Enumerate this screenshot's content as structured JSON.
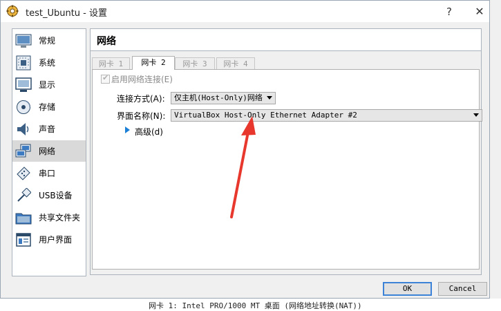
{
  "window": {
    "title": "test_Ubuntu - 设置",
    "help_symbol": "?",
    "close_symbol": "✕"
  },
  "sidebar": {
    "items": [
      {
        "label": "常规",
        "icon": "general-icon"
      },
      {
        "label": "系统",
        "icon": "system-icon"
      },
      {
        "label": "显示",
        "icon": "display-icon"
      },
      {
        "label": "存储",
        "icon": "storage-icon"
      },
      {
        "label": "声音",
        "icon": "audio-icon"
      },
      {
        "label": "网络",
        "icon": "network-icon",
        "selected": true
      },
      {
        "label": "串口",
        "icon": "serial-port-icon"
      },
      {
        "label": "USB设备",
        "icon": "usb-icon"
      },
      {
        "label": "共享文件夹",
        "icon": "shared-folder-icon"
      },
      {
        "label": "用户界面",
        "icon": "user-interface-icon"
      }
    ]
  },
  "content": {
    "header_title": "网络",
    "tabs": [
      "网卡 1",
      "网卡 2",
      "网卡 3",
      "网卡 4"
    ],
    "active_tab": "网卡 2",
    "enable_label": "启用网络连接(E)",
    "enable_checked": true,
    "attached_label": "连接方式(A):",
    "attached_value": "仅主机(Host-Only)网络",
    "name_label": "界面名称(N):",
    "name_value": "VirtualBox Host-Only Ethernet Adapter #2",
    "advanced_label": "高级(d)"
  },
  "buttons": {
    "ok": "OK",
    "cancel": "Cancel"
  },
  "background": {
    "bottom_text": "网卡 1: Intel PRO/1000 MT 桌面 (网络地址转换(NAT))"
  },
  "colors": {
    "accent": "#3c82d6",
    "selected_item": "#d9d9d9",
    "annotation_arrow": "#e8372c"
  }
}
